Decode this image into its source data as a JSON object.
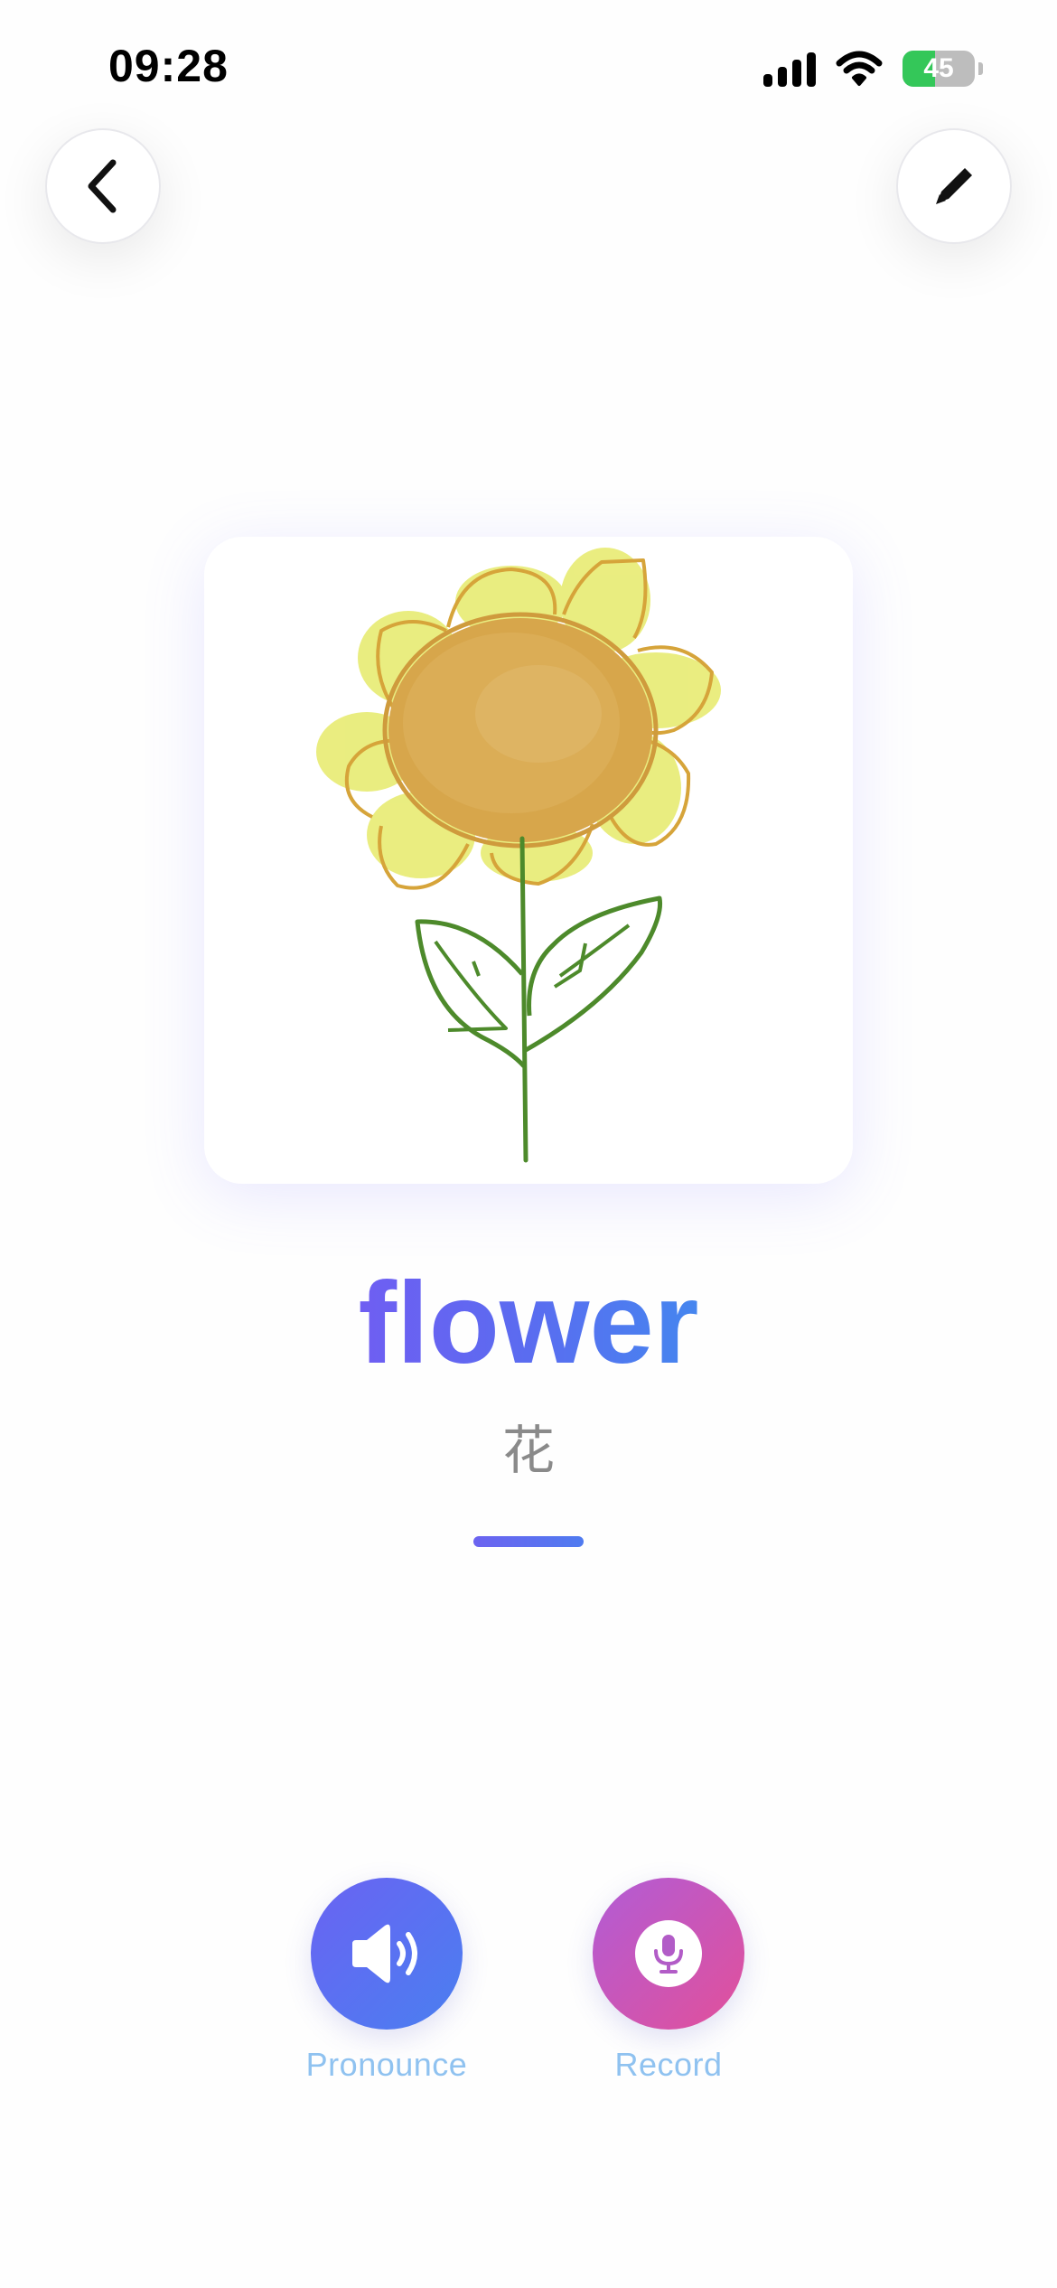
{
  "status_bar": {
    "time": "09:28",
    "battery_level": "45",
    "battery_fraction": 0.45
  },
  "toolbar": {
    "back_icon": "chevron-left-icon",
    "edit_icon": "pencil-icon"
  },
  "card": {
    "image": "sunflower-drawing"
  },
  "word": {
    "text": "flower",
    "translation": "花"
  },
  "actions": {
    "pronounce_label": "Pronounce",
    "pronounce_icon": "speaker-icon",
    "record_label": "Record",
    "record_icon": "microphone-icon"
  },
  "colors": {
    "accent": "#5a6cf0",
    "record_accent": "#d052a8",
    "label": "#8fc2f0",
    "battery_green": "#34c759"
  }
}
